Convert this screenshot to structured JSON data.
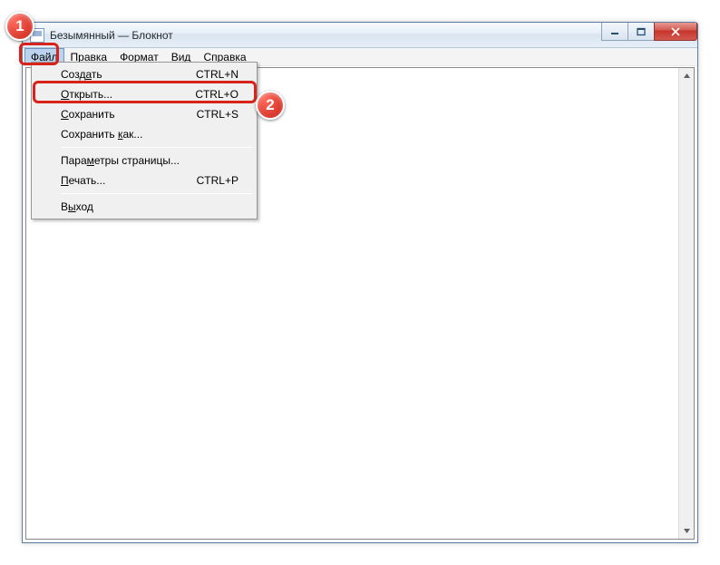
{
  "window": {
    "title": "Безымянный — Блокнот"
  },
  "menubar": {
    "items": [
      {
        "pre": "",
        "hot": "Ф",
        "post": "айл"
      },
      {
        "pre": "",
        "hot": "П",
        "post": "равка"
      },
      {
        "pre": "Фор",
        "hot": "м",
        "post": "ат"
      },
      {
        "pre": "",
        "hot": "В",
        "post": "ид"
      },
      {
        "pre": "",
        "hot": "С",
        "post": "правка"
      }
    ]
  },
  "dropdown": {
    "items": [
      {
        "pre": "Созд",
        "hot": "а",
        "post": "ть",
        "shortcut": "CTRL+N"
      },
      {
        "pre": "",
        "hot": "О",
        "post": "ткрыть...",
        "shortcut": "CTRL+O"
      },
      {
        "pre": "",
        "hot": "С",
        "post": "охранить",
        "shortcut": "CTRL+S"
      },
      {
        "pre": "Сохранить ",
        "hot": "к",
        "post": "ак...",
        "shortcut": ""
      }
    ],
    "items2": [
      {
        "pre": "Пара",
        "hot": "м",
        "post": "етры страницы...",
        "shortcut": ""
      },
      {
        "pre": "",
        "hot": "П",
        "post": "ечать...",
        "shortcut": "CTRL+P"
      }
    ],
    "items3": [
      {
        "pre": "В",
        "hot": "ы",
        "post": "ход",
        "shortcut": ""
      }
    ]
  },
  "callouts": {
    "one": "1",
    "two": "2"
  }
}
